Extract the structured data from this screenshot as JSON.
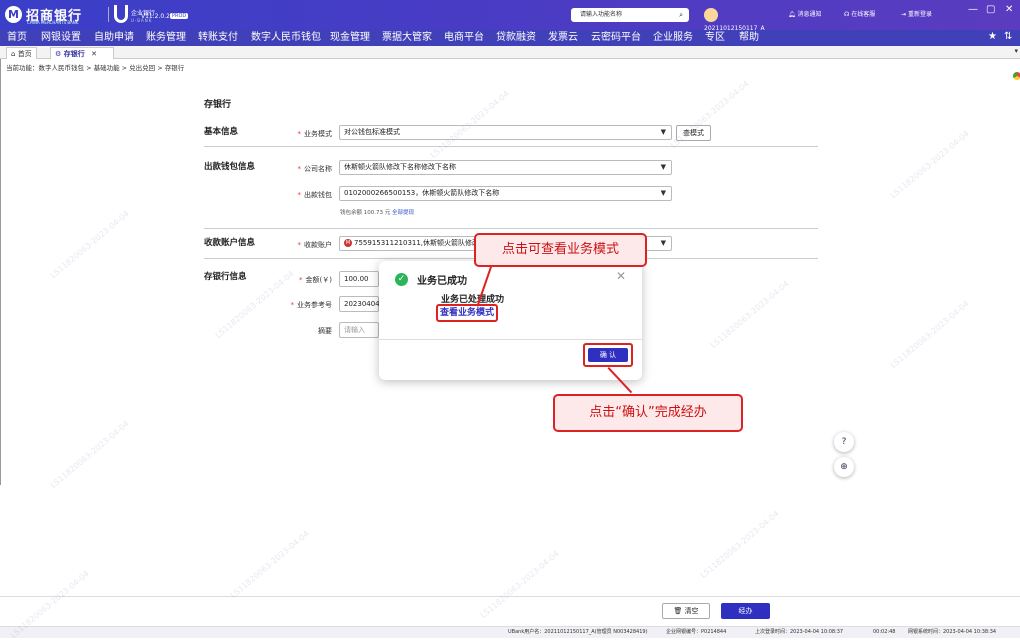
{
  "header": {
    "logo_char": "M",
    "brand": "招商银行",
    "brand_sub": "CHINA MERCHANTS BANK",
    "enterprise": "企业银行",
    "ubank": "U-BANK",
    "version": "V11.2.0.27",
    "version_badge": "PROD",
    "search_placeholder": "请输入功能名称",
    "user": "20211012150117_A",
    "message": "消息通知",
    "service": "在线客服",
    "relogin": "重新登录",
    "minimize": "—",
    "restore": "▢",
    "close": "✕"
  },
  "nav": {
    "items": [
      "首页",
      "网银设置",
      "自助申请",
      "账务管理",
      "转账支付",
      "数字人民币钱包",
      "现金管理",
      "票据大管家",
      "电商平台",
      "贷款融资",
      "发票云",
      "云密码平台",
      "企业服务",
      "专区",
      "帮助"
    ],
    "star": "★",
    "more": "⇅"
  },
  "tabs": {
    "home": "首页",
    "current": "存银行",
    "close": "✕",
    "dropdown": "▾"
  },
  "breadcrumb": "当前功能：数字人民币钱包 > 基础功能 > 兑出兑回 > 存银行",
  "form": {
    "page_title": "存银行",
    "sec_basic": "基本信息",
    "sec_out": "出款钱包信息",
    "sec_in": "收款账户信息",
    "sec_deposit": "存银行信息",
    "lbl_mode": "业务模式",
    "mode_value": "对公钱包标准模式",
    "view_mode_btn": "查模式",
    "lbl_company": "公司名称",
    "company_value": "休斯顿火箭队修改下名称修改下名称",
    "lbl_wallet": "出款钱包",
    "wallet_value": "0102000266500153，休斯顿火箭队修改下名称",
    "balance_text": "钱包余额 100.73 元",
    "balance_link": "全部提现",
    "lbl_account": "收款账户",
    "account_value": "755915311210311,休斯顿火箭队修改",
    "lbl_amount": "金额(￥)",
    "amount_value": "100.00",
    "lbl_ref": "业务参考号",
    "ref_value": "20230404",
    "lbl_memo": "摘要",
    "memo_placeholder": "请输入"
  },
  "modal": {
    "title": "业务已成功",
    "message": "业务已处理成功",
    "link": "查看业务模式",
    "confirm": "确 认",
    "close": "✕",
    "check": "✓"
  },
  "callouts": {
    "top": "点击可查看业务模式",
    "bottom": "点击“确认”完成经办"
  },
  "float": {
    "help": "?",
    "zoom": "⊕"
  },
  "bottom": {
    "clear": "清空",
    "submit": "经办",
    "clear_icon": "🗑"
  },
  "status": {
    "user": "UBank用户名：20211012150117_A(管理员 N003428419)",
    "corp": "企业网银编号：P0214844",
    "last_login": "上次登录时间：2023-04-04 10:08:37",
    "session": "00:02:48",
    "system_time": "网银系统时间：2023-04-04 10:38:34"
  },
  "watermark": "LS11820063-2023-04-04"
}
